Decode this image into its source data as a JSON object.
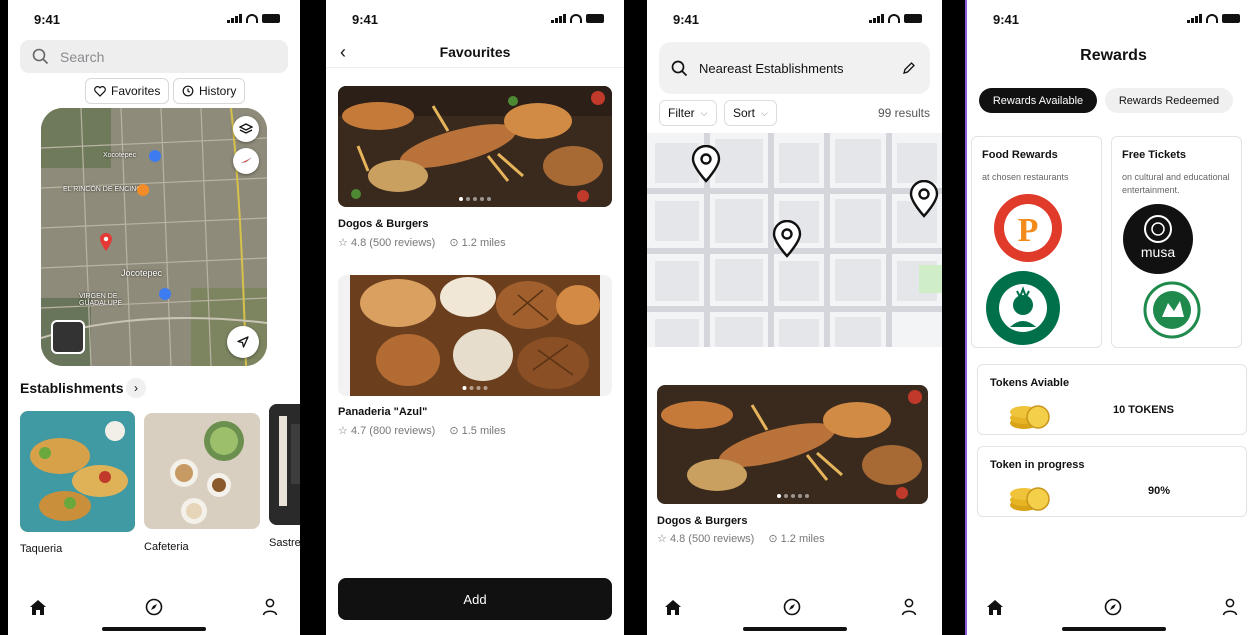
{
  "status": {
    "time": "9:41"
  },
  "screen1": {
    "search_placeholder": "Search",
    "favorites_label": "Favorites",
    "history_label": "History",
    "map_labels": [
      "Xocotepec",
      "EL RINCÓN DE ENCINO",
      "Jocotepec",
      "VIRGEN DE GUADALUPE"
    ],
    "section_title": "Establishments",
    "establishments": [
      "Taqueria",
      "Cafeteria",
      "Sastre"
    ]
  },
  "screen2": {
    "title": "Favourites",
    "cards": [
      {
        "name": "Dogos & Burgers",
        "rating": "4.8 (500 reviews)",
        "distance": "1.2 miles"
      },
      {
        "name": "Panaderia \"Azul\"",
        "rating": "4.7 (800 reviews)",
        "distance": "1.5 miles"
      }
    ],
    "add_label": "Add"
  },
  "screen3": {
    "search_value": "Neareast  Establishments",
    "filter_label": "Filter",
    "sort_label": "Sort",
    "results": "99 results",
    "card": {
      "name": "Dogos & Burgers",
      "rating": "4.8 (500 reviews)",
      "distance": "1.2 miles"
    }
  },
  "screen4": {
    "title": "Rewards",
    "tab_available": "Rewards Available",
    "tab_redeemed": "Rewards Redeemed",
    "food": {
      "title": "Food Rewards",
      "desc": "at chosen restaurants"
    },
    "tickets": {
      "title": "Free Tickets",
      "desc": "on cultural and educational entertainment."
    },
    "logos": {
      "musa": "musa"
    },
    "tokens": {
      "title": "Tokens Aviable",
      "value": "10 TOKENS"
    },
    "progress": {
      "title": "Token in progress",
      "value": "90%"
    }
  },
  "colors": {
    "accent": "#111111",
    "pin": "#e53935",
    "chip_bg": "#eeeeef"
  }
}
